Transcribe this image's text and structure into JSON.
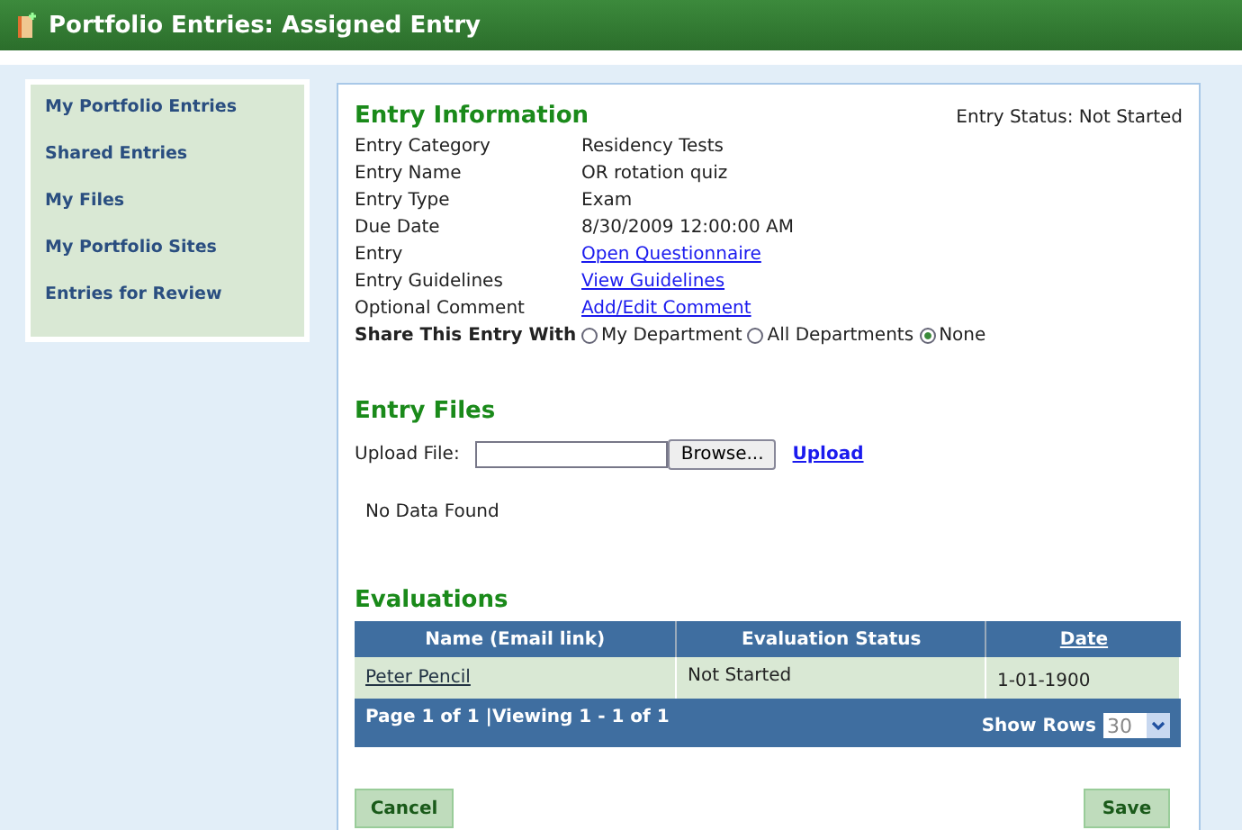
{
  "header": {
    "title": "Portfolio Entries: Assigned Entry"
  },
  "sidebar": {
    "items": [
      {
        "label": "My Portfolio Entries"
      },
      {
        "label": "Shared Entries"
      },
      {
        "label": "My Files"
      },
      {
        "label": "My Portfolio Sites"
      },
      {
        "label": "Entries for Review"
      }
    ]
  },
  "entry_information": {
    "title": "Entry Information",
    "status": "Entry Status: Not Started",
    "fields": [
      {
        "label": "Entry Category",
        "value": "Residency Tests",
        "kind": "text"
      },
      {
        "label": "Entry Name",
        "value": "OR rotation quiz",
        "kind": "text"
      },
      {
        "label": "Entry Type",
        "value": "Exam",
        "kind": "text"
      },
      {
        "label": "Due Date",
        "value": "8/30/2009 12:00:00 AM",
        "kind": "text"
      },
      {
        "label": "Entry",
        "value": "Open Questionnaire",
        "kind": "link"
      },
      {
        "label": "Entry Guidelines",
        "value": "View Guidelines",
        "kind": "link"
      },
      {
        "label": "Optional Comment",
        "value": "Add/Edit Comment",
        "kind": "link"
      }
    ],
    "share": {
      "label": "Share This Entry With",
      "options": [
        {
          "label": "My Department",
          "selected": false
        },
        {
          "label": "All Departments",
          "selected": false
        },
        {
          "label": "None",
          "selected": true
        }
      ]
    }
  },
  "entry_files": {
    "title": "Entry Files",
    "upload_label": "Upload File:",
    "browse": "Browse...",
    "upload": "Upload",
    "empty": "No Data Found"
  },
  "evaluations": {
    "title": "Evaluations",
    "columns": [
      {
        "label": "Name (Email link)",
        "sortable": false
      },
      {
        "label": "Evaluation Status",
        "sortable": false
      },
      {
        "label": "Date",
        "sortable": true
      }
    ],
    "rows": [
      {
        "name": "Peter Pencil",
        "status": "Not Started",
        "date": "1-01-1900"
      }
    ],
    "pager": "Page 1 of 1 |Viewing 1 - 1 of 1",
    "show_rows_label": "Show Rows",
    "show_rows_value": "30"
  },
  "buttons": [
    {
      "label": "Cancel"
    },
    {
      "label": "Save"
    }
  ]
}
